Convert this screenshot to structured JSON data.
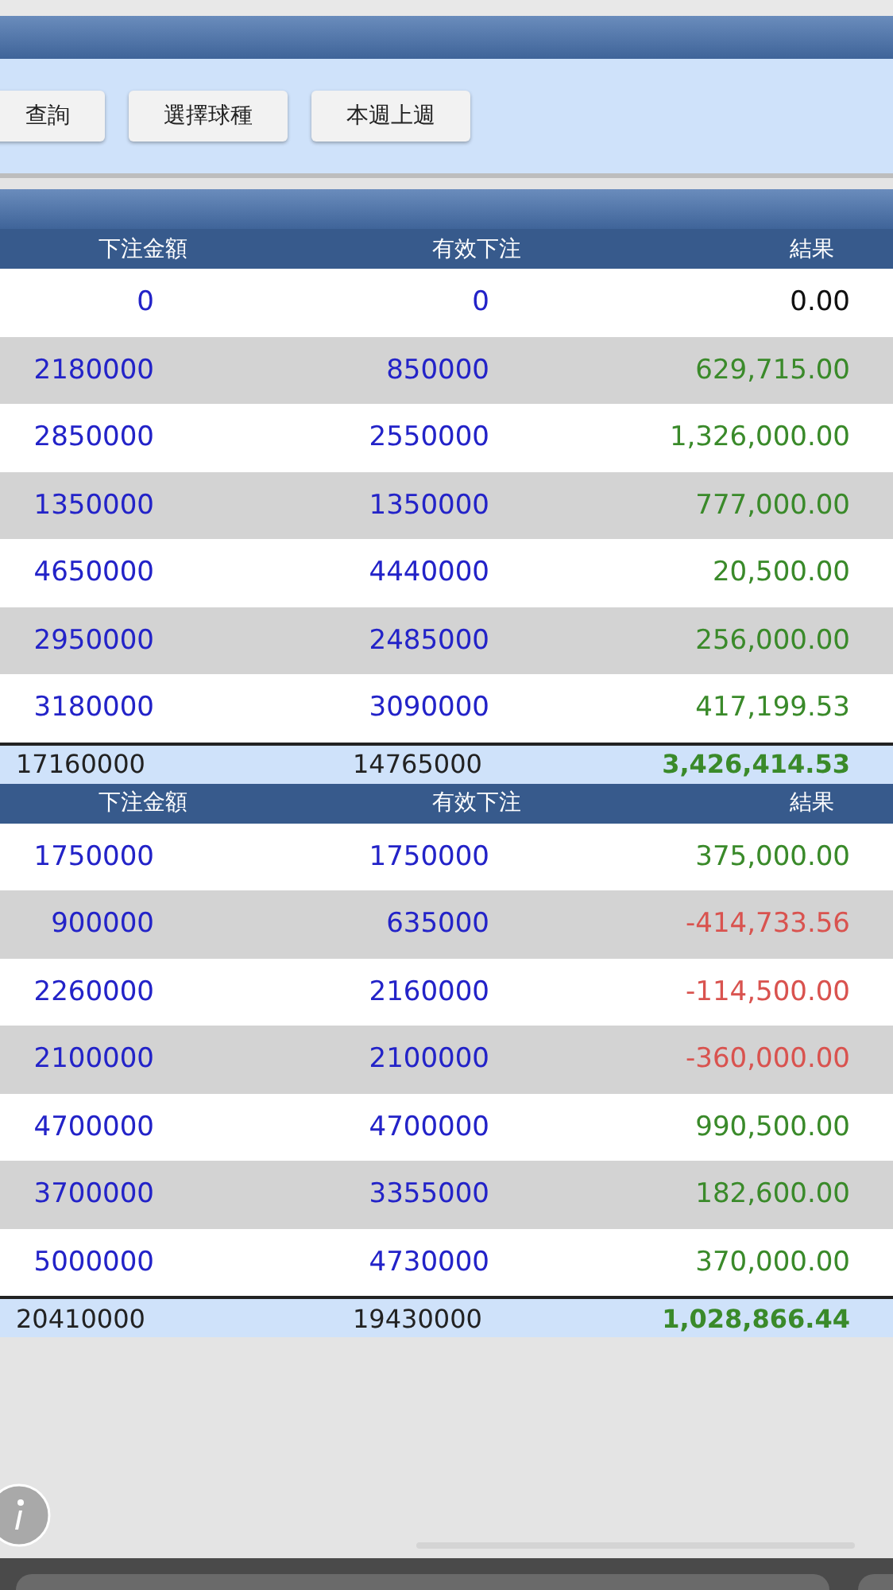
{
  "toolbar": {
    "buttons": [
      "查詢",
      "選擇球種",
      "本週上週"
    ]
  },
  "tables": [
    {
      "columns": [
        "下注金額",
        "有效下注",
        "結果"
      ],
      "rows": [
        {
          "bet": "0",
          "valid": "0",
          "result": "0.00",
          "color": "#111111"
        },
        {
          "bet": "2180000",
          "valid": "850000",
          "result": "629,715.00",
          "color": "#3a8a2a"
        },
        {
          "bet": "2850000",
          "valid": "2550000",
          "result": "1,326,000.00",
          "color": "#3a8a2a"
        },
        {
          "bet": "1350000",
          "valid": "1350000",
          "result": "777,000.00",
          "color": "#3a8a2a"
        },
        {
          "bet": "4650000",
          "valid": "4440000",
          "result": "20,500.00",
          "color": "#3a8a2a"
        },
        {
          "bet": "2950000",
          "valid": "2485000",
          "result": "256,000.00",
          "color": "#3a8a2a"
        },
        {
          "bet": "3180000",
          "valid": "3090000",
          "result": "417,199.53",
          "color": "#3a8a2a"
        }
      ],
      "total": {
        "bet": "17160000",
        "valid": "14765000",
        "result": "3,426,414.53",
        "color": "#3a8a2a"
      }
    },
    {
      "columns": [
        "下注金額",
        "有效下注",
        "結果"
      ],
      "rows": [
        {
          "bet": "1750000",
          "valid": "1750000",
          "result": "375,000.00",
          "color": "#3a8a2a"
        },
        {
          "bet": "900000",
          "valid": "635000",
          "result": "-414,733.56",
          "color": "#d9534f"
        },
        {
          "bet": "2260000",
          "valid": "2160000",
          "result": "-114,500.00",
          "color": "#d9534f"
        },
        {
          "bet": "2100000",
          "valid": "2100000",
          "result": "-360,000.00",
          "color": "#d9534f"
        },
        {
          "bet": "4700000",
          "valid": "4700000",
          "result": "990,500.00",
          "color": "#3a8a2a"
        },
        {
          "bet": "3700000",
          "valid": "3355000",
          "result": "182,600.00",
          "color": "#3a8a2a"
        },
        {
          "bet": "5000000",
          "valid": "4730000",
          "result": "370,000.00",
          "color": "#3a8a2a"
        }
      ],
      "total": {
        "bet": "20410000",
        "valid": "19430000",
        "result": "1,028,866.44",
        "color": "#3a8a2a"
      }
    }
  ]
}
